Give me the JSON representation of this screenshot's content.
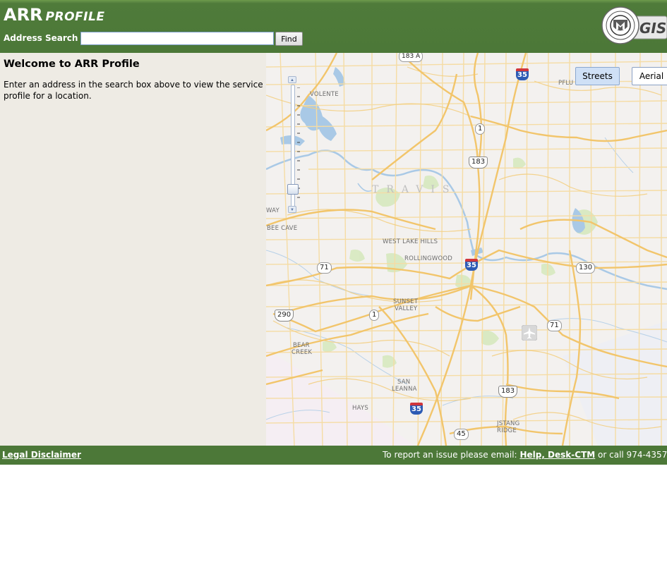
{
  "header": {
    "title": "ARR",
    "subtitle": "PROFILE",
    "search_label": "Address Search",
    "search_value": "",
    "find_label": "Find",
    "logo_text": "GIS"
  },
  "panel": {
    "title": "Welcome to ARR Profile",
    "text": "Enter an address in the search box above to view the service profile for a location."
  },
  "map": {
    "basemap_buttons": {
      "streets": "Streets",
      "aerial": "Aerial"
    },
    "places": {
      "volente": "VOLENTE",
      "pflu": "PFLU",
      "travis": "TRAVIS",
      "way": "WAY",
      "bee_cave": "BEE CAVE",
      "west_lake_hills": "WEST LAKE HILLS",
      "rollingwood": "ROLLINGWOOD",
      "sunset_valley_1": "SUNSET",
      "sunset_valley_2": "VALLEY",
      "bear_creek_1": "BEAR",
      "bear_creek_2": "CREEK",
      "san_leanna_1": "SAN",
      "san_leanna_2": "LEANNA",
      "hays": "HAYS",
      "mustang_ridge_1": "JSTANG",
      "mustang_ridge_2": "RIDGE"
    },
    "shields": {
      "s183a": "183 A",
      "i35_north": "35",
      "s1_north": "1",
      "us183_north": "183",
      "s71_west": "71",
      "i35_center": "35",
      "s130": "130",
      "us290": "290",
      "s1_south": "1",
      "s71_east": "71",
      "us183_south": "183",
      "i35_south": "35",
      "s45": "45"
    },
    "colors": {
      "roads": "#f6d68e",
      "water": "#a7c8e4",
      "parks": "#d4e8b8",
      "background": "#f3f1ef"
    }
  },
  "footer": {
    "disclaimer": "Legal Disclaimer",
    "report_prefix": "To report an issue please email:",
    "email_link": "Help, Desk-CTM",
    "report_suffix": "or call 974-4357"
  },
  "colors": {
    "header_green": "#4c7838",
    "panel_bg": "#eeebe4"
  }
}
